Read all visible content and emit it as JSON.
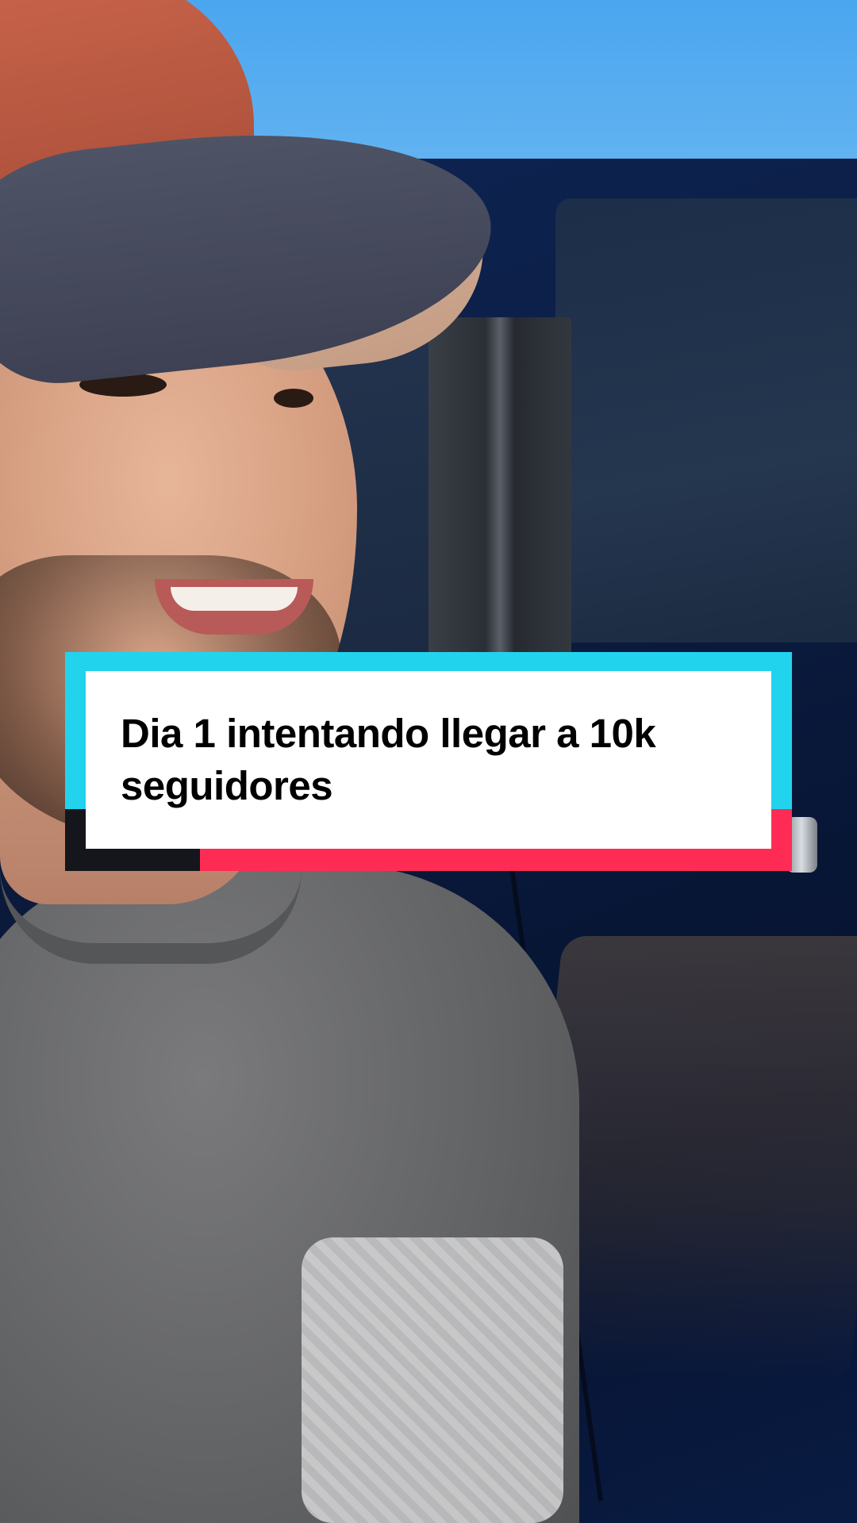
{
  "caption": {
    "text": "Dia 1 intentando llegar a 10k seguidores"
  },
  "colors": {
    "caption_frame_cyan": "#22d3ee",
    "caption_frame_pink": "#fe2c55",
    "caption_frame_dark": "#14161c",
    "caption_card_bg": "#ffffff",
    "caption_text": "#000000"
  }
}
